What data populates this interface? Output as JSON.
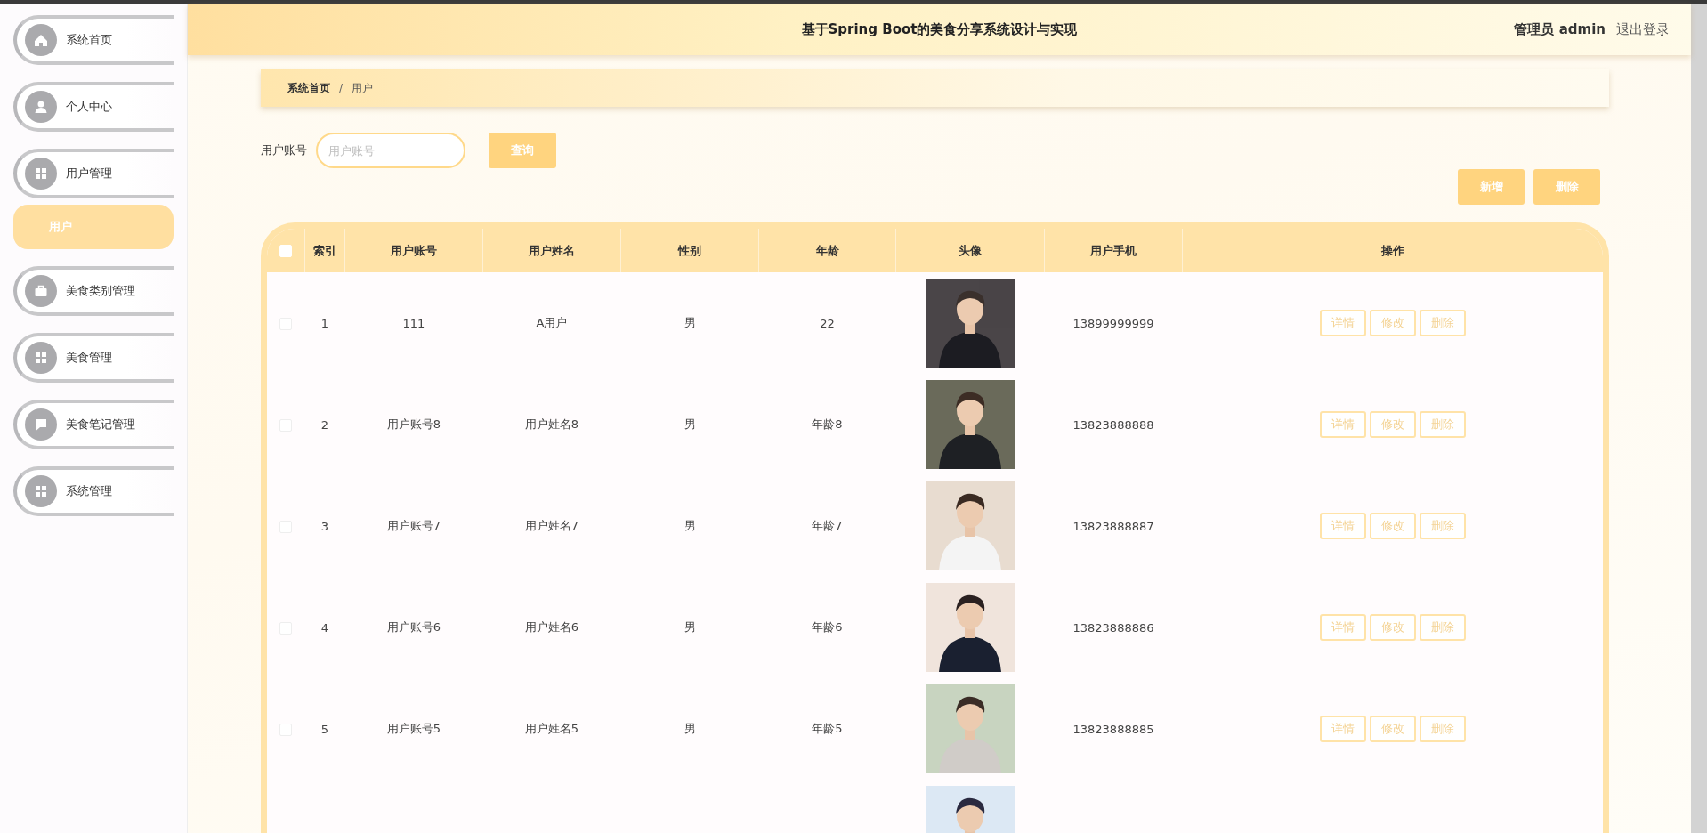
{
  "sidebar": {
    "items": [
      {
        "label": "系统首页",
        "selected": false
      },
      {
        "label": "个人中心",
        "selected": false
      },
      {
        "label": "用户管理",
        "selected": false,
        "expanded": true,
        "children": [
          {
            "label": "用户",
            "selected": true
          }
        ]
      },
      {
        "label": "美食类别管理",
        "selected": false
      },
      {
        "label": "美食管理",
        "selected": false
      },
      {
        "label": "美食笔记管理",
        "selected": false
      },
      {
        "label": "系统管理",
        "selected": false
      }
    ]
  },
  "header": {
    "title": "基于Spring Boot的美食分享系统设计与实现",
    "user": "管理员 admin",
    "logout": "退出登录"
  },
  "breadcrumb": [
    "系统首页",
    "用户"
  ],
  "breadcrumb_separator": "/",
  "search": {
    "label": "用户账号",
    "placeholder": "用户账号",
    "button": "查询"
  },
  "toolbar": [
    "新增",
    "删除"
  ],
  "table": {
    "columns": [
      "索引",
      "用户账号",
      "用户姓名",
      "性别",
      "年龄",
      "头像",
      "用户手机",
      "操作"
    ],
    "header_checked": false,
    "rows": [
      {
        "checked": false,
        "cells": [
          "1",
          "111",
          "A用户",
          "男",
          "22"
        ],
        "avatar": {
          "kind": "picture"
        },
        "phone": "13899999999",
        "actions": [
          "详情",
          "修改",
          "删除"
        ]
      },
      {
        "checked": false,
        "cells": [
          "2",
          "用户账号8",
          "用户姓名8",
          "男",
          "年龄8"
        ],
        "avatar": {
          "kind": "picture"
        },
        "phone": "13823888888",
        "actions": [
          "详情",
          "修改",
          "删除"
        ]
      },
      {
        "checked": false,
        "cells": [
          "3",
          "用户账号7",
          "用户姓名7",
          "男",
          "年龄7"
        ],
        "avatar": {
          "kind": "picture"
        },
        "phone": "13823888887",
        "actions": [
          "详情",
          "修改",
          "删除"
        ]
      },
      {
        "checked": false,
        "cells": [
          "4",
          "用户账号6",
          "用户姓名6",
          "男",
          "年龄6"
        ],
        "avatar": {
          "kind": "picture"
        },
        "phone": "13823888886",
        "actions": [
          "详情",
          "修改",
          "删除"
        ]
      },
      {
        "checked": false,
        "cells": [
          "5",
          "用户账号5",
          "用户姓名5",
          "男",
          "年龄5"
        ],
        "avatar": {
          "kind": "picture"
        },
        "phone": "13823888885",
        "actions": [
          "详情",
          "修改",
          "删除"
        ]
      },
      {
        "avatar": {
          "kind": "picture"
        }
      }
    ]
  }
}
